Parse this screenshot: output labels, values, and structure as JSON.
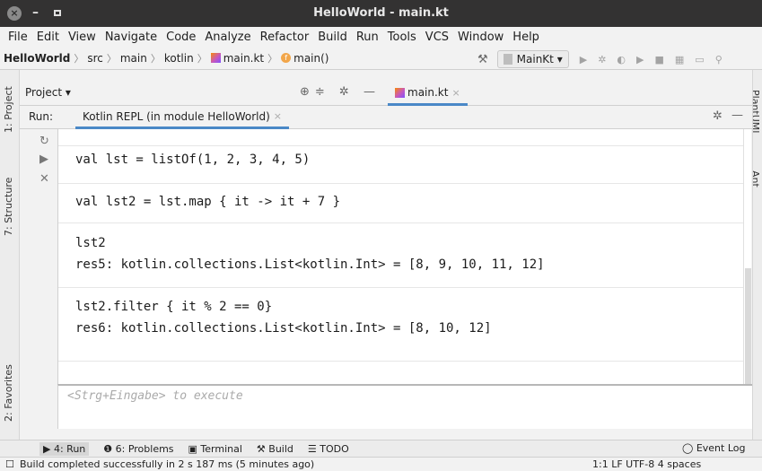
{
  "window": {
    "title": "HelloWorld - main.kt",
    "close": "×",
    "minimize": "–"
  },
  "menu": [
    "File",
    "Edit",
    "View",
    "Navigate",
    "Code",
    "Analyze",
    "Refactor",
    "Build",
    "Run",
    "Tools",
    "VCS",
    "Window",
    "Help"
  ],
  "breadcrumb": [
    "HelloWorld",
    "src",
    "main",
    "kotlin",
    "main.kt",
    "main()"
  ],
  "toolbar": {
    "run_config": "MainKt ▾"
  },
  "project_panel": {
    "label": "Project ▾",
    "tab": "main.kt"
  },
  "run_panel": {
    "label": "Run:",
    "tab": "Kotlin REPL (in module HelloWorld)"
  },
  "console": {
    "lines": [
      "val lst = listOf(1, 2, 3, 4, 5)",
      "val lst2 = lst.map { it -> it + 7 }",
      "lst2",
      "res5: kotlin.collections.List<kotlin.Int> = [8, 9, 10, 11, 12]",
      "lst2.filter { it % 2 == 0}",
      "res6: kotlin.collections.List<kotlin.Int> = [8, 10, 12]"
    ],
    "input_placeholder": "<Strg+Eingabe> to execute"
  },
  "side_tabs": {
    "project": "1: Project",
    "structure": "7: Structure",
    "favorites": "2: Favorites",
    "plantuml": "PlantUML",
    "ant": "Ant"
  },
  "bottom_tabs": [
    "4: Run",
    "6: Problems",
    "Terminal",
    "Build",
    "TODO"
  ],
  "event_log": "Event Log",
  "status": {
    "message": "Build completed successfully in 2 s 187 ms (5 minutes ago)",
    "right": "1:1  LF  UTF-8  4 spaces"
  },
  "colors": {
    "titlebar": "#333232",
    "accent": "#4a88c7",
    "kotlin": "#7f52ff"
  }
}
